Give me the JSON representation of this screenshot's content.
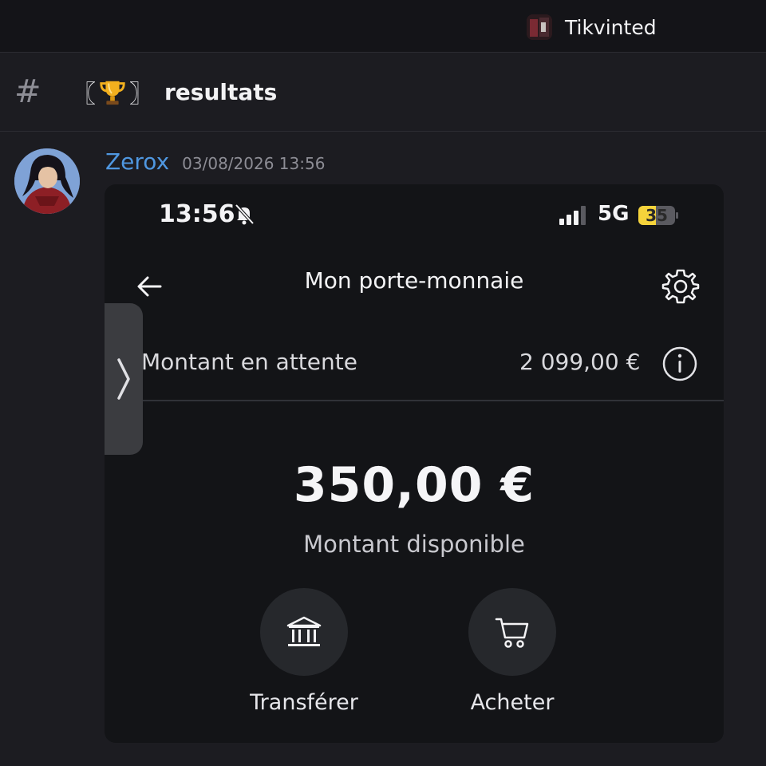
{
  "server": {
    "name": "Tikvinted",
    "icon": "server-avatar"
  },
  "channel": {
    "prefix": "#",
    "bracket_open": "〖",
    "emoji": "trophy-icon",
    "bracket_close": "〗",
    "name": "resultats"
  },
  "message": {
    "author": "Zerox",
    "timestamp": "03/08/2026 13:56",
    "author_color": "#4f97e0"
  },
  "phone": {
    "status": {
      "time": "13:56",
      "network": "5G",
      "battery": "35",
      "battery_color": "#f5d33b"
    },
    "title": "Mon porte-monnaie",
    "pending": {
      "label": "Montant en attente",
      "value": "2 099,00 €"
    },
    "balance": {
      "amount": "350,00 €",
      "label": "Montant disponible"
    },
    "actions": [
      {
        "label": "Transférer",
        "icon": "bank-icon"
      },
      {
        "label": "Acheter",
        "icon": "cart-icon"
      }
    ]
  }
}
